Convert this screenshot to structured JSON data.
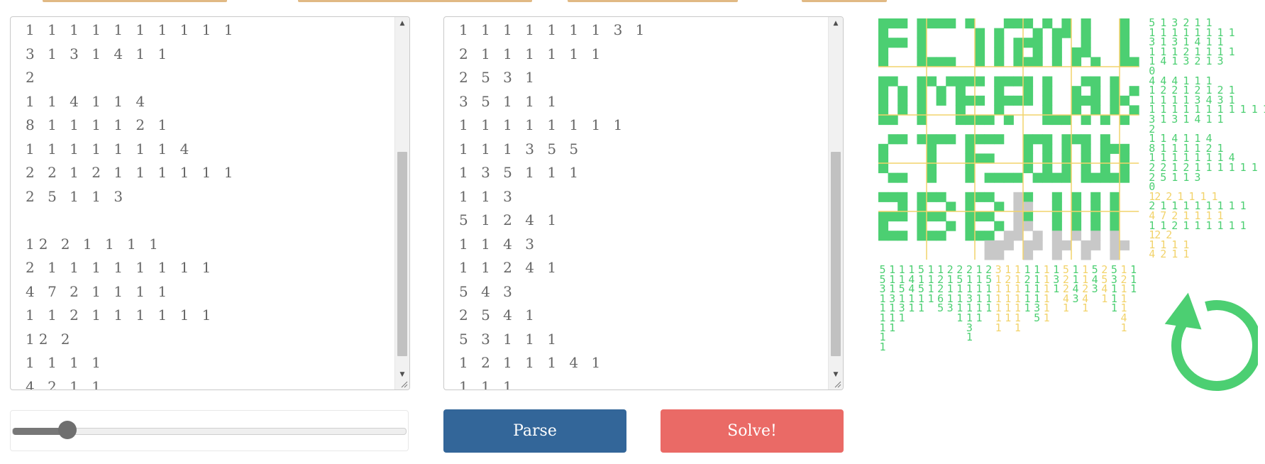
{
  "textareas": {
    "left_lines": [
      "1 1 1 1 1 1 1 1 1 1",
      "3 1 3 1 4 1 1",
      "2",
      "1 1 4 1 1 4",
      "8 1 1 1 1 2 1",
      "1 1 1 1 1 1 1 4",
      "2 2 1 2 1 1 1 1 1 1",
      "2 5 1 1 3",
      "",
      "12 2 1 1 1 1",
      "2 1 1 1 1 1 1 1 1",
      "4 7 2 1 1 1 1",
      "1 1 2 1 1 1 1 1 1",
      "12 2",
      "1 1 1 1",
      "4 2 1 1"
    ],
    "right_lines": [
      "1 1 1 1 1 1 1 3 1",
      "2 1 1 1 1 1 1",
      "2 5 3 1",
      "3 5 1 1 1",
      "1 1 1 1 1 1 1 1",
      "1 1 1 3 5 5",
      "1 3 5 1 1 1",
      "1 1 3",
      "5 1 2 4 1",
      "1 1 4 3",
      "1 1 2 4 1",
      "5 4 3",
      "2 5 4 1",
      "5 3 1 1 1",
      "1 2 1 1 1 4 1",
      "1 1 1"
    ],
    "left_scroll_fraction": 0.62,
    "right_scroll_fraction": 0.62
  },
  "slider": {
    "value_fraction": 0.14
  },
  "buttons": {
    "parse_label": "Parse",
    "solve_label": "Solve!"
  },
  "puzzle": {
    "image_text": "FLAGKIL  DMEPLAK  ctf_DWB  2BB_Il|||",
    "colors": {
      "filled": "#4ccf72",
      "unknown": "#c8c8c8",
      "gridline": "#f2d36b",
      "clue_done": "#4ccf72",
      "clue_pending": "#f2d36b"
    },
    "row_clues": [
      {
        "text": "5 1 3 2 1 1",
        "state": "done"
      },
      {
        "text": "1 1 1 1 1 1 1 1",
        "state": "done"
      },
      {
        "text": "3 1 3 1 4 1 1",
        "state": "done"
      },
      {
        "text": "1 1 1 2 1 1 1 1",
        "state": "done"
      },
      {
        "text": "1 4 1 3 2 1 3",
        "state": "done"
      },
      {
        "text": "0",
        "state": "done"
      },
      {
        "text": "4 4 4 1 1 1",
        "state": "done"
      },
      {
        "text": "1 2 2 1 2 1 2 1",
        "state": "done"
      },
      {
        "text": "1 1 1 1 3 4 3 1",
        "state": "done"
      },
      {
        "text": "1 1 1 1 1 1 1 1 1 1 1",
        "state": "done"
      },
      {
        "text": "3 1 3 1 4 1 1",
        "state": "done"
      },
      {
        "text": "2",
        "state": "done"
      },
      {
        "text": "1 1 4 1 1 4",
        "state": "done"
      },
      {
        "text": "8 1 1 1 1 2 1",
        "state": "done"
      },
      {
        "text": "1 1 1 1 1 1 1 4",
        "state": "done"
      },
      {
        "text": "2 2 1 2 1 1 1 1 1 1",
        "state": "done"
      },
      {
        "text": "2 5 1 1 3",
        "state": "done"
      },
      {
        "text": "0",
        "state": "done"
      },
      {
        "text": "12 2 1 1 1 1",
        "state": "pending"
      },
      {
        "text": "2 1 1 1 1 1 1 1 1",
        "state": "done"
      },
      {
        "text": "4 7 2 1 1 1 1",
        "state": "pending"
      },
      {
        "text": "1 1 2 1 1 1 1 1 1",
        "state": "done"
      },
      {
        "text": "12 2",
        "state": "pending"
      },
      {
        "text": "1 1 1 1",
        "state": "pending"
      },
      {
        "text": "4 2 1 1",
        "state": "pending"
      }
    ],
    "col_clues": [
      {
        "text": "5 5 3 1 1 1 1 1 1",
        "state": "done"
      },
      {
        "text": "1 1 1 3 1 1 1",
        "state": "done"
      },
      {
        "text": "1 1 5 1 3 1",
        "state": "done"
      },
      {
        "text": "1 4 4 1 1",
        "state": "done"
      },
      {
        "text": "5 1 5 1 1",
        "state": "done"
      },
      {
        "text": "1 1 1 1",
        "state": "done"
      },
      {
        "text": "1 2 2 6 5",
        "state": "done"
      },
      {
        "text": "2 1 1 1 3",
        "state": "done"
      },
      {
        "text": "2 5 1 1 1 1",
        "state": "done"
      },
      {
        "text": "2 1 1 3 1 1 3 1",
        "state": "done"
      },
      {
        "text": "1 1 1 1 1 1",
        "state": "done"
      },
      {
        "text": "2 5 1 1 1",
        "state": "done"
      },
      {
        "text": "3 1 1 1 1 1 1",
        "state": "pending"
      },
      {
        "text": "1 2 1 1 1 1",
        "state": "pending"
      },
      {
        "text": "1 1 1 1 1 1 1",
        "state": "pending"
      },
      {
        "text": "1 2 1 1 1",
        "state": "done"
      },
      {
        "text": "1 1 1 1 3 5",
        "state": "done"
      },
      {
        "text": "1 1 1 1 1 1",
        "state": "pending"
      },
      {
        "text": "1 3 1",
        "state": "done"
      },
      {
        "text": "5 2 2 4 1",
        "state": "pending"
      },
      {
        "text": "1 1 4 3",
        "state": "done"
      },
      {
        "text": "1 1 2 4 1",
        "state": "pending"
      },
      {
        "text": "5 4 3",
        "state": "done"
      },
      {
        "text": "2 5 4 1",
        "state": "pending"
      },
      {
        "text": "5 3 1 1 1",
        "state": "done"
      },
      {
        "text": "1 2 1 1 1 4 1",
        "state": "pending"
      },
      {
        "text": "1 1 1",
        "state": "done"
      }
    ]
  },
  "icons": {
    "refresh": "refresh-icon"
  }
}
